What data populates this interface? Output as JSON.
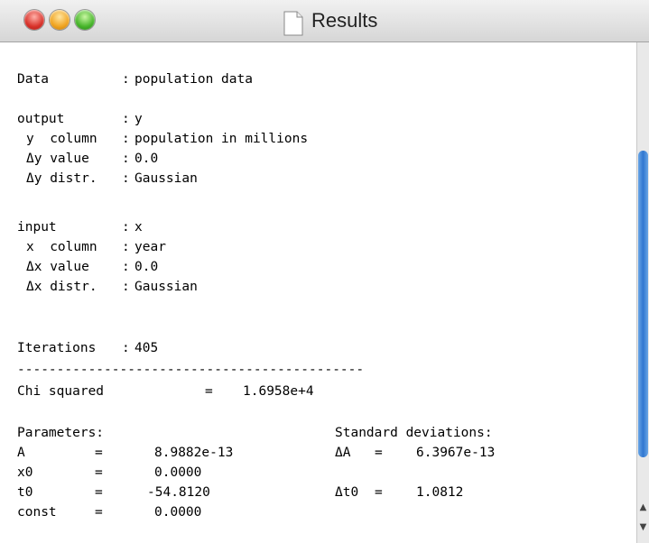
{
  "window": {
    "title": "Results"
  },
  "content": {
    "data_label": "Data",
    "data_value": "population data",
    "output_label": "output",
    "output_value": "y",
    "y_column_label": "y  column",
    "y_column_value": "population in millions",
    "dy_value_label": "Δy value",
    "dy_value_value": "0.0",
    "dy_distr_label": "Δy distr.",
    "dy_distr_value": "Gaussian",
    "input_label": "input",
    "input_value": "x",
    "x_column_label": "x  column",
    "x_column_value": "year",
    "dx_value_label": "Δx value",
    "dx_value_value": "0.0",
    "dx_distr_label": "Δx distr.",
    "dx_distr_value": "Gaussian",
    "iterations_label": "Iterations",
    "iterations_value": "405",
    "separator": "--------------------------------------------",
    "chi_label": "Chi squared",
    "chi_value": "1.6958e+4",
    "parameters_header": "Parameters:",
    "std_header": "Standard deviations:",
    "params": [
      {
        "name": "A",
        "value": "8.9882e-13",
        "std_name": "ΔA",
        "std_value": "6.3967e-13"
      },
      {
        "name": "x0",
        "value": "0.0000",
        "std_name": "",
        "std_value": ""
      },
      {
        "name": "t0",
        "value": "-54.8120",
        "std_name": "Δt0",
        "std_value": "1.0812"
      },
      {
        "name": "const",
        "value": "0.0000",
        "std_name": "",
        "std_value": ""
      }
    ],
    "equals": "=",
    "colon": ":"
  }
}
